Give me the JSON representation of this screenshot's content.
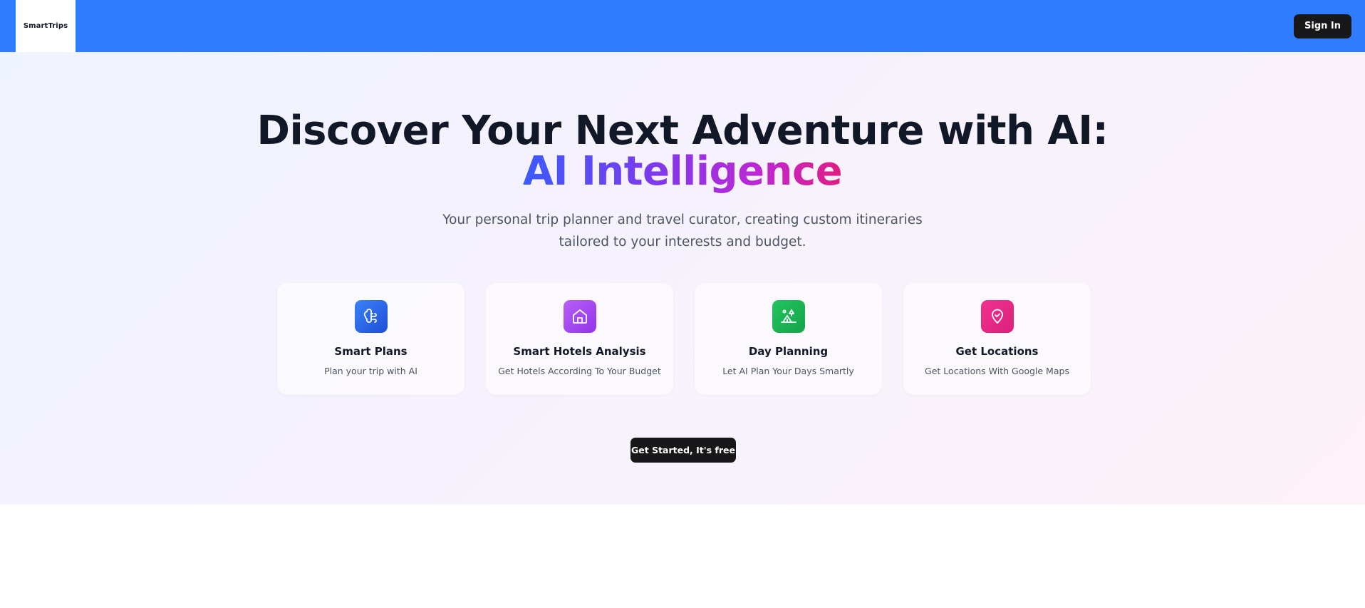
{
  "navbar": {
    "logo_text": "SmartTrips",
    "signin_label": "Sign In",
    "background_color": "#2f7cff"
  },
  "hero": {
    "headline_main": "Discover Your Next Adventure with AI: ",
    "headline_accent": "AI Intelligence",
    "subtitle": "Your personal trip planner and travel curator, creating custom itineraries tailored to your interests and budget.",
    "cta_label": "Get Started, It's free"
  },
  "features": [
    {
      "title": "Smart Plans",
      "description": "Plan your trip with AI",
      "icon": "brain-icon",
      "color": "#2563eb"
    },
    {
      "title": "Smart Hotels Analysis",
      "description": "Get Hotels According To Your Budget",
      "icon": "home-icon",
      "color": "#a43cf2"
    },
    {
      "title": "Day Planning",
      "description": "Let AI Plan Your Days Smartly",
      "icon": "tent-icon",
      "color": "#16a34a"
    },
    {
      "title": "Get Locations",
      "description": "Get Locations With Google Maps",
      "icon": "map-pin-check-icon",
      "color": "#ec1f8e"
    }
  ]
}
